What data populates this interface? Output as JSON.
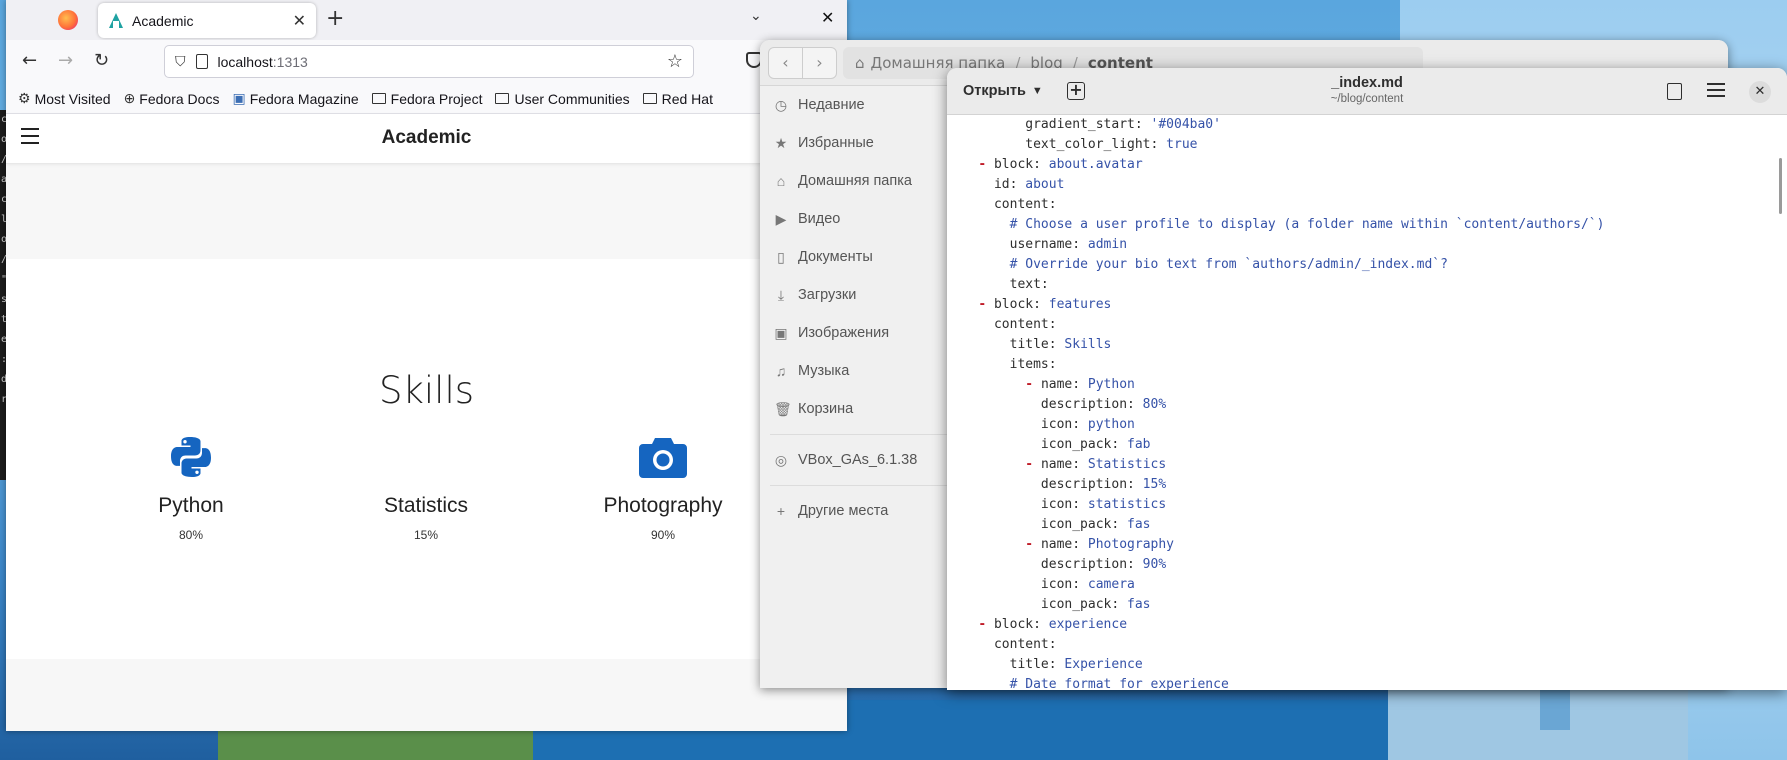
{
  "terminal": {
    "chars": [
      "c",
      "o",
      "/",
      "a",
      "c",
      "l",
      "o",
      "/",
      "\"",
      "",
      "s",
      "",
      "",
      "t",
      "",
      "",
      "e",
      ":",
      "d",
      "r"
    ]
  },
  "firefox": {
    "tab_title": "Academic",
    "url_host": "localhost",
    "url_port": ":1313",
    "bookmarks": [
      "Most Visited",
      "Fedora Docs",
      "Fedora Magazine",
      "Fedora Project",
      "User Communities",
      "Red Hat"
    ],
    "site": {
      "brand": "Academic",
      "section_title": "Skills",
      "skills": [
        {
          "name": "Python",
          "description": "80%",
          "icon": "python-icon"
        },
        {
          "name": "Statistics",
          "description": "15%",
          "icon": "statistics-icon"
        },
        {
          "name": "Photography",
          "description": "90%",
          "icon": "camera-icon"
        }
      ]
    }
  },
  "nautilus": {
    "path": {
      "home": "Домашняя папка",
      "seg1": "blog",
      "current": "content"
    },
    "sidebar": [
      {
        "label": "Недавние",
        "icon": "clock-icon"
      },
      {
        "label": "Избранные",
        "icon": "star-icon"
      },
      {
        "label": "Домашняя папка",
        "icon": "home-icon"
      },
      {
        "label": "Видео",
        "icon": "video-icon"
      },
      {
        "label": "Документы",
        "icon": "document-icon"
      },
      {
        "label": "Загрузки",
        "icon": "download-icon"
      },
      {
        "label": "Изображения",
        "icon": "image-icon"
      },
      {
        "label": "Музыка",
        "icon": "music-icon"
      },
      {
        "label": "Корзина",
        "icon": "trash-icon"
      }
    ],
    "device": "VBox_GAs_6.1.38",
    "other_places": "Другие места"
  },
  "editor": {
    "open_label": "Открыть",
    "file_name": "_index.md",
    "file_path": "~/blog/content",
    "lines": [
      "        gradient_start: '#004ba0'",
      "        text_color_light: true",
      "  - block: about.avatar",
      "    id: about",
      "    content:",
      "      # Choose a user profile to display (a folder name within `content/authors/`)",
      "      username: admin",
      "      # Override your bio text from `authors/admin/_index.md`?",
      "      text:",
      "  - block: features",
      "    content:",
      "      title: Skills",
      "      items:",
      "        - name: Python",
      "          description: 80%",
      "          icon: python",
      "          icon_pack: fab",
      "        - name: Statistics",
      "          description: 15%",
      "          icon: statistics",
      "          icon_pack: fas",
      "        - name: Photography",
      "          description: 90%",
      "          icon: camera",
      "          icon_pack: fas",
      "  - block: experience",
      "    content:",
      "      title: Experience",
      "      # Date format for experience"
    ]
  }
}
